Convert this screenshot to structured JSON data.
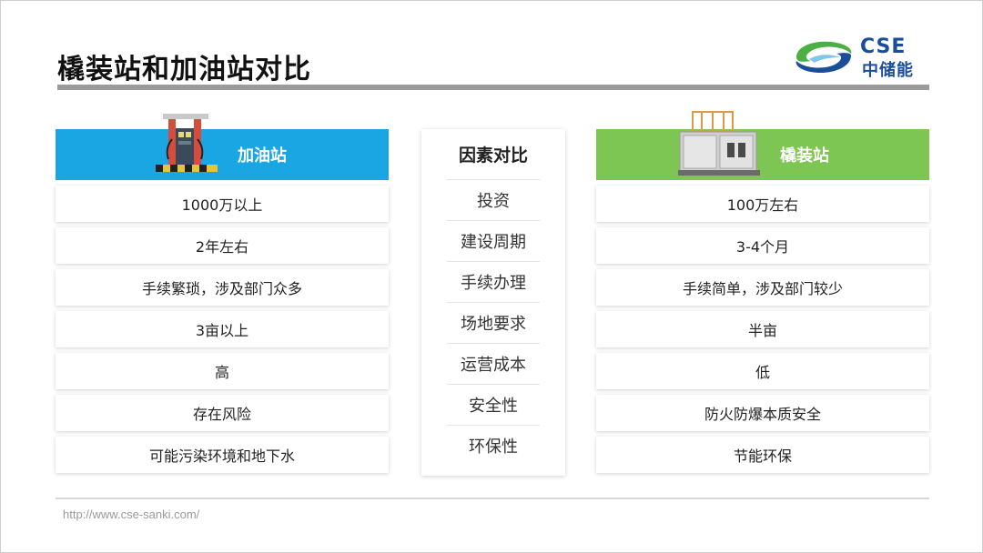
{
  "title": "橇装站和加油站对比",
  "logo": {
    "brand_en": "CSE",
    "brand_cn": "中储能",
    "colors": {
      "green": "#4bb043",
      "blue": "#1a4e9a"
    }
  },
  "left": {
    "header": "加油站",
    "color": "#1aa6e3",
    "icon": "fuel-pump-icon",
    "rows": [
      "1000万以上",
      "2年左右",
      "手续繁琐，涉及部门众多",
      "3亩以上",
      "高",
      "存在风险",
      "可能污染环境和地下水"
    ]
  },
  "center": {
    "header": "因素对比",
    "rows": [
      "投资",
      "建设周期",
      "手续办理",
      "场地要求",
      "运营成本",
      "安全性",
      "环保性"
    ]
  },
  "right": {
    "header": "橇装站",
    "color": "#7ec653",
    "icon": "skid-station-icon",
    "rows": [
      "100万左右",
      "3-4个月",
      "手续简单，涉及部门较少",
      "半亩",
      "低",
      "防火防爆本质安全",
      "节能环保"
    ]
  },
  "footer": {
    "url": "http://www.cse-sanki.com/"
  }
}
